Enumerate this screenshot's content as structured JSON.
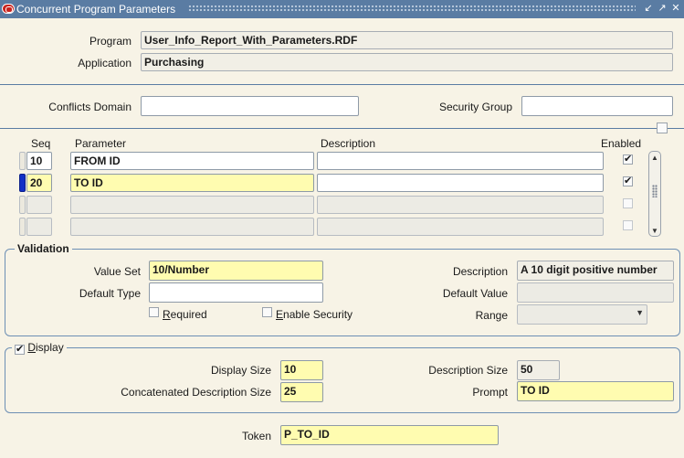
{
  "window": {
    "title": "Concurrent Program Parameters",
    "controls": [
      "↙",
      "↗",
      "✕"
    ]
  },
  "header": {
    "program_label": "Program",
    "program_value": "User_Info_Report_With_Parameters.RDF",
    "application_label": "Application",
    "application_value": "Purchasing"
  },
  "context": {
    "conflicts_domain_label": "Conflicts Domain",
    "conflicts_domain_value": "",
    "security_group_label": "Security Group",
    "security_group_value": ""
  },
  "table": {
    "columns": {
      "seq": "Seq",
      "parameter": "Parameter",
      "description": "Description",
      "enabled": "Enabled"
    },
    "rows": [
      {
        "seq": "10",
        "parameter": "FROM ID",
        "description": "",
        "enabled": "✔"
      },
      {
        "seq": "20",
        "parameter": "TO ID",
        "description": "",
        "enabled": "✔"
      },
      {
        "seq": "",
        "parameter": "",
        "description": "",
        "enabled": ""
      },
      {
        "seq": "",
        "parameter": "",
        "description": "",
        "enabled": ""
      }
    ],
    "scroll_up": "▲",
    "scroll_down": "▼"
  },
  "validation": {
    "legend": "Validation",
    "value_set_label": "Value Set",
    "value_set_value": "10/Number",
    "description_label": "Description",
    "description_value": "A 10 digit positive number",
    "default_type_label": "Default Type",
    "default_type_value": "",
    "default_value_label": "Default Value",
    "default_value_value": "",
    "required_label_u": "R",
    "required_label_rest": "equired",
    "enable_security_label_u": "E",
    "enable_security_label_rest": "nable Security",
    "range_label": "Range",
    "range_value": "",
    "dropdown_arrow": "▼"
  },
  "display": {
    "legend_u": "D",
    "legend_rest": "isplay",
    "checked": "✔",
    "display_size_label": "Display Size",
    "display_size_value": "10",
    "description_size_label": "Description Size",
    "description_size_value": "50",
    "concat_desc_size_label": "Concatenated Description Size",
    "concat_desc_size_value": "25",
    "prompt_label": "Prompt",
    "prompt_value": "TO ID"
  },
  "token": {
    "label": "Token",
    "value": "P_TO_ID"
  },
  "colors": {
    "title_bar": "#5a7ca3",
    "canvas": "#f7f3e6",
    "current_record_field": "#fffcb0",
    "current_row_indicator": "#1231c6"
  }
}
